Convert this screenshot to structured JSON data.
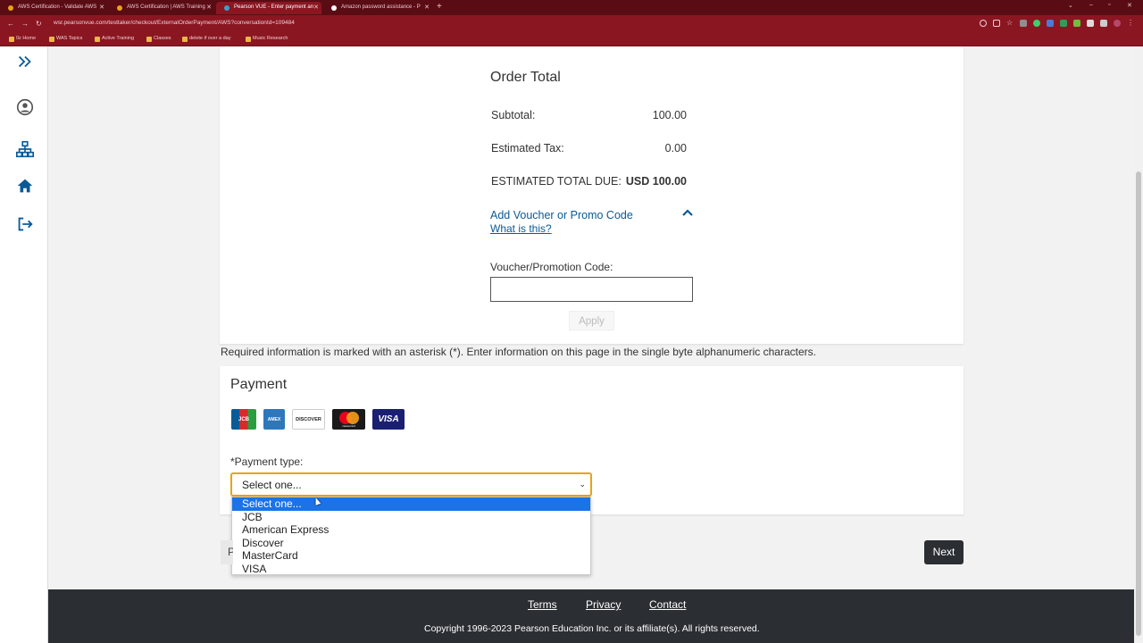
{
  "browser": {
    "tabs": [
      {
        "title": "AWS Certification - Validate AWS",
        "icon_color": "#e8a317"
      },
      {
        "title": "AWS Certification | AWS Training",
        "icon_color": "#e8a317"
      },
      {
        "title": "Pearson VUE - Enter payment an",
        "icon_color": "#3aa0c8"
      },
      {
        "title": "Amazon password assistance - P",
        "icon_color": "#ffffff"
      }
    ],
    "new_tab": "+",
    "url": "wsr.pearsonvue.com/testtaker/checkout/ExternalOrderPayment/AWS?conversationId=109484",
    "bookmarks": [
      "0z Home",
      "WAS Topics",
      "Active Training",
      "Classes",
      "delete if over a day",
      "Music Research"
    ]
  },
  "order": {
    "title": "Order Total",
    "subtotal_label": "Subtotal:",
    "subtotal_value": "100.00",
    "tax_label": "Estimated Tax:",
    "tax_value": "0.00",
    "total_label": "ESTIMATED TOTAL DUE:",
    "total_value": "USD 100.00",
    "voucher_toggle": "Add Voucher or Promo Code",
    "what_is_this": "What is this?",
    "voucher_label": "Voucher/Promotion Code:",
    "voucher_value": "",
    "apply_label": "Apply"
  },
  "required_note": "Required information is marked with an asterisk (*). Enter information on this page in the single byte alphanumeric characters.",
  "payment": {
    "title": "Payment",
    "card_logos": [
      {
        "name": "JCB",
        "color": "#0b5a96"
      },
      {
        "name": "AMEX",
        "color": "#2e77bb"
      },
      {
        "name": "DISCOVER",
        "color": "#ffffff"
      },
      {
        "name": "mastercard",
        "color": "#1a1a1a"
      },
      {
        "name": "VISA",
        "color": "#1a1f71"
      }
    ],
    "type_label": "*Payment type:",
    "selected": "Select one...",
    "options": [
      "Select one...",
      "JCB",
      "American Express",
      "Discover",
      "MasterCard",
      "VISA"
    ]
  },
  "buttons": {
    "next": "Next",
    "back": "P"
  },
  "footer": {
    "terms": "Terms",
    "privacy": "Privacy",
    "contact": "Contact",
    "copyright": "Copyright 1996-2023 Pearson Education Inc. or its affiliate(s). All rights reserved."
  },
  "colors": {
    "accent": "#0b5a96",
    "focus": "#e8a317",
    "browser_chrome": "#8a1622",
    "footer": "#2b2f33"
  }
}
